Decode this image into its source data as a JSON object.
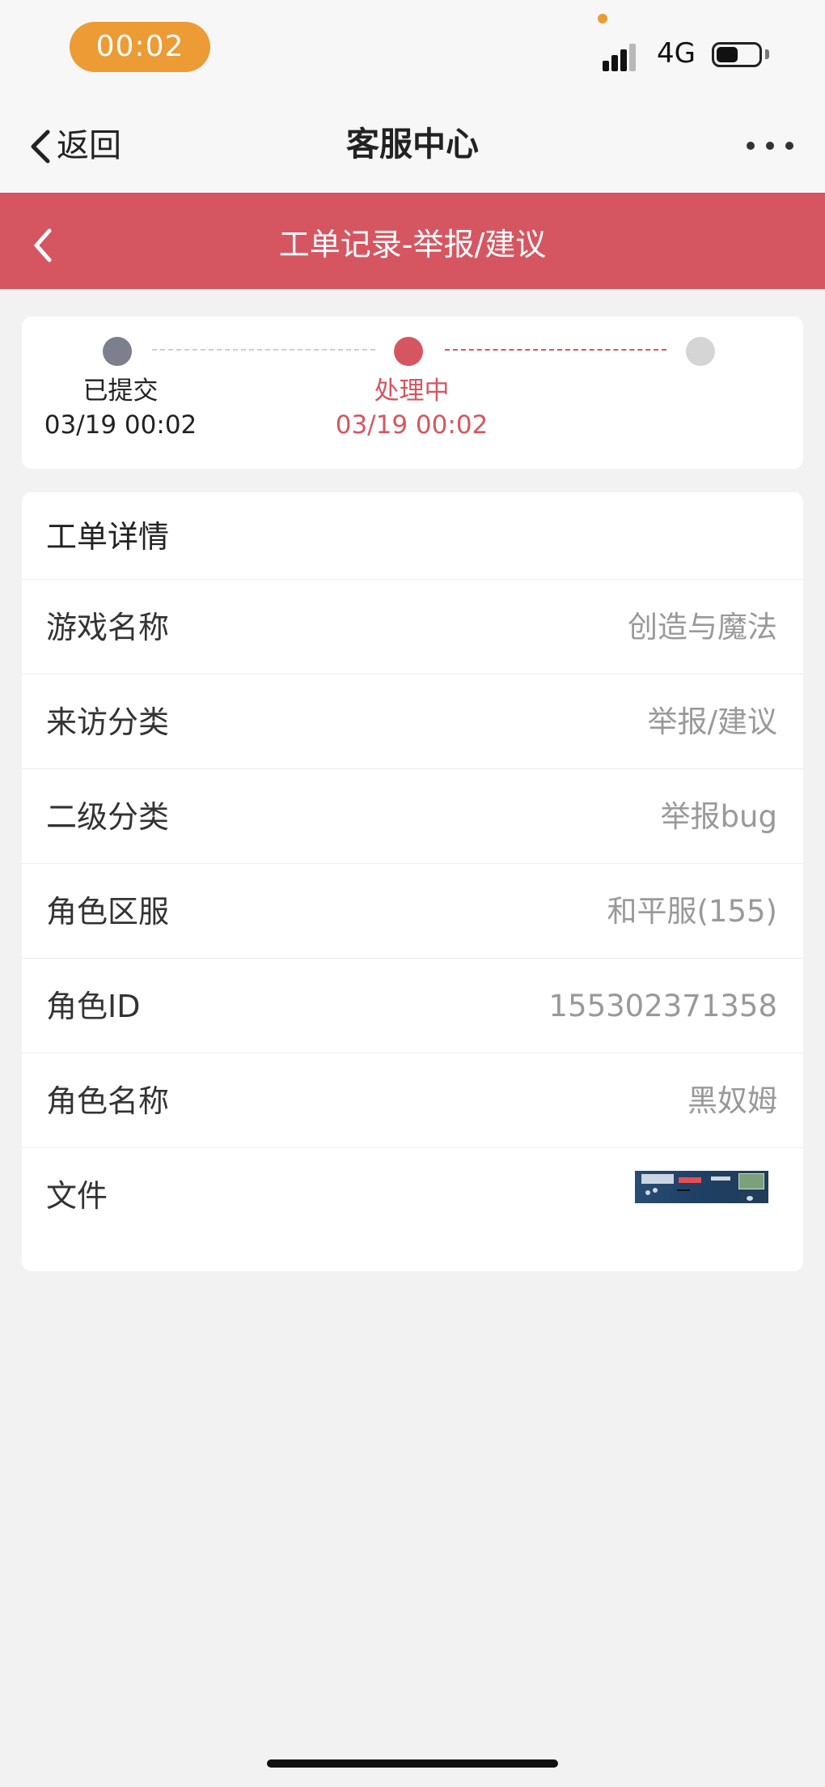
{
  "status_bar": {
    "time": "00:02",
    "network": "4G",
    "icons": [
      "signal-icon",
      "battery-icon"
    ]
  },
  "top_nav": {
    "back_label": "返回",
    "title": "客服中心",
    "icons": [
      "back-chevron-icon",
      "more-icon"
    ]
  },
  "ticket_header": {
    "title": "工单记录-举报/建议",
    "icons": [
      "back-chevron-icon"
    ]
  },
  "progress": {
    "steps": [
      {
        "label": "已提交",
        "time": "03/19 00:02",
        "status_color": "#7d7f8d"
      },
      {
        "label": "处理中",
        "time": "03/19 00:02",
        "status_color": "#d55661"
      },
      {
        "label": "",
        "time": "",
        "status_color": "#d5d5d5"
      }
    ]
  },
  "details": {
    "title": "工单详情",
    "rows": [
      {
        "label": "游戏名称",
        "value": "创造与魔法"
      },
      {
        "label": "来访分类",
        "value": "举报/建议"
      },
      {
        "label": "二级分类",
        "value": "举报bug"
      },
      {
        "label": "角色区服",
        "value": "和平服(155)"
      },
      {
        "label": "角色ID",
        "value": "155302371358"
      },
      {
        "label": "角色名称",
        "value": "黑奴姆"
      },
      {
        "label": "文件",
        "value": ""
      }
    ]
  },
  "colors": {
    "accent": "#d55661",
    "time_pill": "#ec9b35"
  }
}
